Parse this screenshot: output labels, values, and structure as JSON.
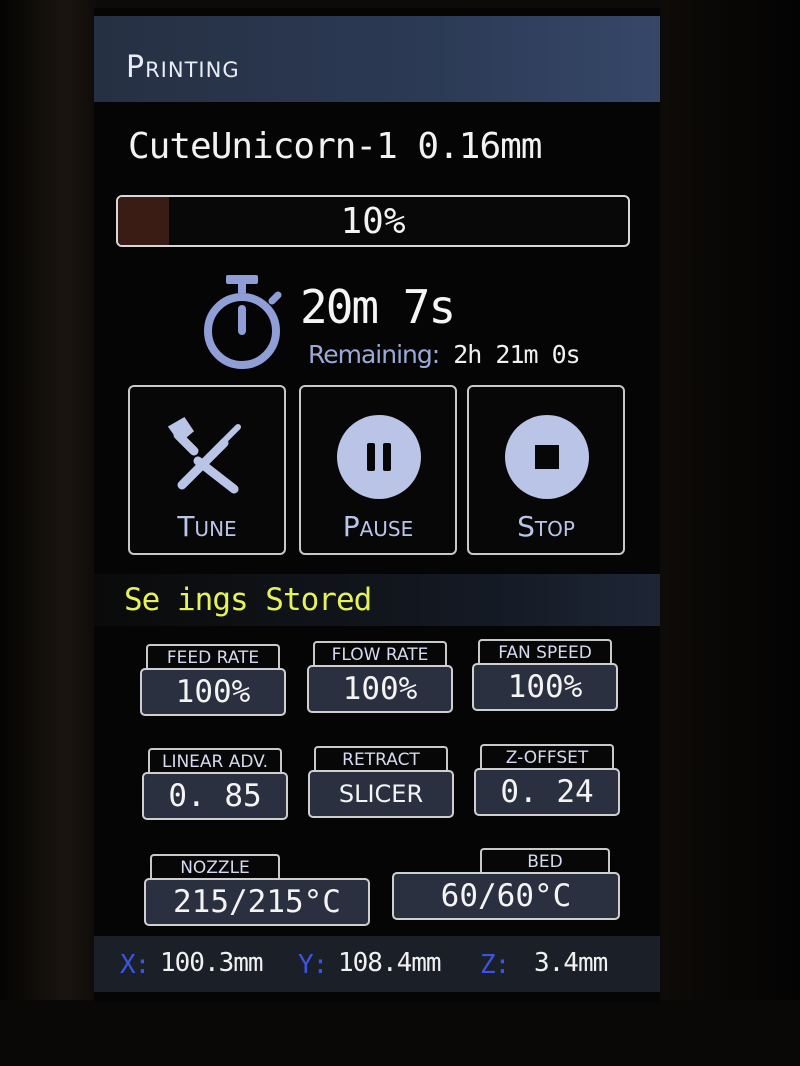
{
  "header": {
    "title": "Printing"
  },
  "job": {
    "file_name": "CuteUnicorn-1 0.16mm"
  },
  "progress": {
    "percent": 10,
    "label": "10%"
  },
  "time": {
    "elapsed": "20m 7s",
    "remaining_label": "Remaining:",
    "remaining_value": "2h 21m 0s",
    "icon": "stopwatch-icon"
  },
  "actions": {
    "tune": {
      "label": "Tune",
      "icon": "tools-icon"
    },
    "pause": {
      "label": "Pause",
      "icon": "pause-icon"
    },
    "stop": {
      "label": "Stop",
      "icon": "stop-icon"
    }
  },
  "status": {
    "message": "Se ings Stored"
  },
  "settings": {
    "feed_rate": {
      "label": "FEED RATE",
      "value": "100%"
    },
    "flow_rate": {
      "label": "FLOW RATE",
      "value": "100%"
    },
    "fan_speed": {
      "label": "FAN SPEED",
      "value": "100%"
    },
    "linear_adv": {
      "label": "LINEAR ADV.",
      "value": "0. 85"
    },
    "retract": {
      "label": "RETRACT",
      "value": "SLICER"
    },
    "z_offset": {
      "label": "Z-OFFSET",
      "value": "0. 24"
    },
    "nozzle": {
      "label": "NOZZLE",
      "value": "215/215°C"
    },
    "bed": {
      "label": "BED",
      "value": "60/60°C"
    }
  },
  "position": {
    "x_label": "X:",
    "x_value": "100.3mm",
    "y_label": "Y:",
    "y_value": "108.4mm",
    "z_label": "Z:",
    "z_value": "3.4mm"
  },
  "colors": {
    "accent": "#b9c4e6",
    "status_text": "#e6f25a",
    "axis_label": "#3c55e0",
    "progress_fill": "#3a1c14"
  }
}
